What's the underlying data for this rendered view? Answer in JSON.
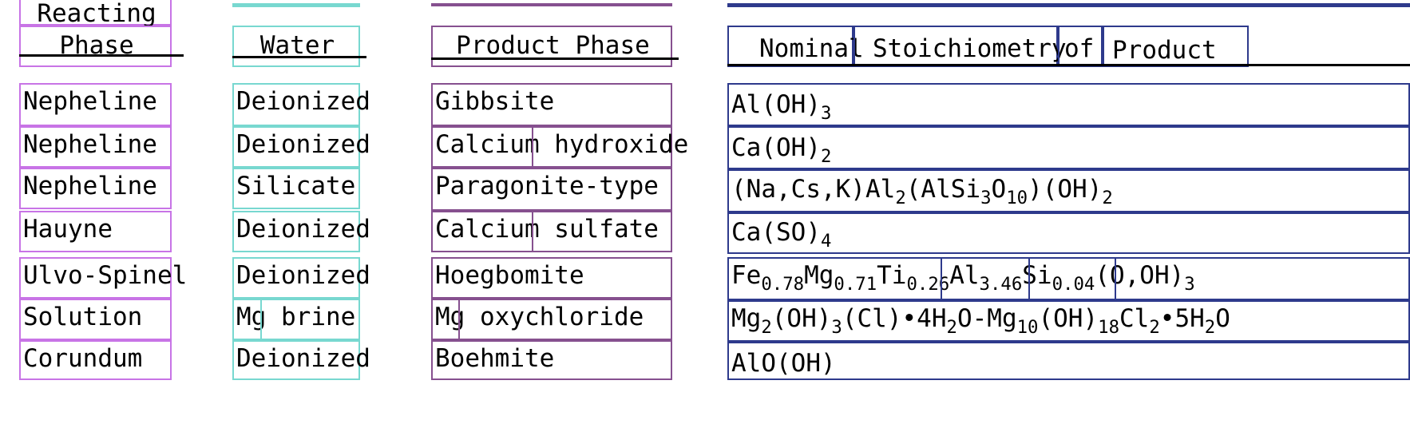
{
  "columns": {
    "reacting_phase": {
      "header_line1": "Reacting",
      "header_line2": "Phase",
      "rows": [
        "Nepheline",
        "Nepheline",
        "Nepheline",
        "Hauyne",
        "Ulvo-Spinel",
        "Solution",
        "Corundum"
      ]
    },
    "water": {
      "header": "Water",
      "rows": [
        "Deionized",
        "Deionized",
        "Silicate",
        "Deionized",
        "Deionized",
        "Mg brine",
        "Deionized"
      ]
    },
    "product_phase": {
      "header": "Product Phase",
      "rows": [
        "Gibbsite",
        "Calcium hydroxide",
        "Paragonite-type",
        "Calcium sulfate",
        "Hoegbomite",
        "Mg oxychloride",
        "Boehmite"
      ]
    },
    "stoichiometry": {
      "header_words": [
        "Nominal",
        "Stoichiometry",
        "of",
        "Product"
      ],
      "rows": [
        "Al(OH)3",
        "Ca(OH)2",
        "(Na,Cs,K)Al2(AlSi3O10)(OH)2",
        "Ca(SO)4",
        "Fe0.78Mg0.71Ti0.26Al3.46Si0.04(O,OH)3",
        "Mg2(OH)3(Cl)•4H2O-Mg10(OH)18Cl2•5H2O",
        "AlO(OH)"
      ]
    }
  },
  "colors": {
    "reacting_phase": "#c874e6",
    "water": "#78d8d0",
    "product_phase": "#86508f",
    "stoichiometry": "#2e3a8c"
  }
}
